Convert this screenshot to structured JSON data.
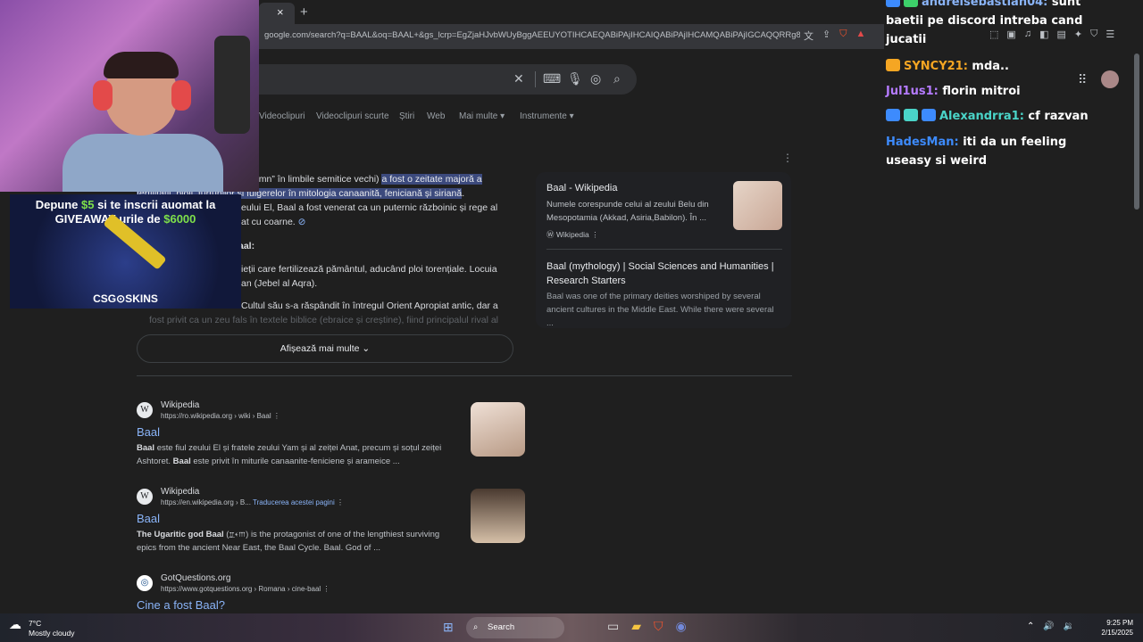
{
  "browser": {
    "tab_close": "×",
    "tab_new": "+",
    "url": "google.com/search?q=BAAL&oq=BAAL+&gs_lcrp=EgZjaHJvbWUyBggAEEUYOTIHCAEQABiPAjIHCAIQABiPAjIHCAMQABiPAjIGCAQQRRg8MgYI8...",
    "addr_icons": [
      "translate-icon",
      "share-icon",
      "brave-icon",
      "warning-icon"
    ]
  },
  "search": {
    "clear": "✕",
    "keyboard": "⌨",
    "mic": "🎤",
    "lens": "◎",
    "search": "⌕"
  },
  "filters": [
    "Videoclipuri",
    "Videoclipuri scurte",
    "Știri",
    "Web",
    "Mai multe ▾",
    "Instrumente ▾"
  ],
  "snippet": {
    "l1a": "au „domn” în limbile semitice vechi) ",
    "l1b": "a fost o zeitate majoră a",
    "l2": "fertilității, ploii, furtunilor și fulgerelor în mitologia canaanită, feniciană și siriană",
    "l2end": ".",
    "l3": "eului El, Baal a fost venerat ca un puternic războinic și rege al",
    "l4": "at cu coarne.",
    "l5": "aal:",
    "l6": "ieții care fertilizează pământul, aducând ploi torențiale. Locuia",
    "l7": "an (Jebel al Aqra).",
    "l8": "Cultul său s-a răspândit în întregul Orient Apropiat antic, dar a",
    "l9": "fost privit ca un zeu fals în textele biblice (ebraice și creștine), fiind principalul rival al",
    "show_more": "Afișează mai multe ⌄"
  },
  "side_cards": [
    {
      "title": "Baal - Wikipedia",
      "desc": "Numele corespunde celui al zeului Belu din Mesopotamia (Akkad, Asiria,Babilon). În ...",
      "source": "Wikipedia"
    },
    {
      "title": "Baal (mythology) | Social Sciences and Humanities | Research Starters",
      "desc": "Baal was one of the primary deities worshiped by several ancient cultures in the Middle East. While there were several ..."
    }
  ],
  "results": [
    {
      "fav": "W",
      "site": "Wikipedia",
      "url": "https://ro.wikipedia.org › wiki › Baal",
      "title": "Baal",
      "desc_b1": "Baal",
      "desc_t1": " este fiul zeului El și fratele zeului Yam și al zeiței Anat, precum și soțul zeiței Ashtoret. ",
      "desc_b2": "Baal",
      "desc_t2": " este privit în miturile canaanite-feniciene și arameice ..."
    },
    {
      "fav": "W",
      "site": "Wikipedia",
      "url": "https://en.wikipedia.org › B...",
      "translate": "Traducerea acestei pagini",
      "title": "Baal",
      "desc_b1": "The Ugaritic god Baal",
      "desc_t1": " (𐎁𐎓𐎍) is the protagonist of one of the lengthiest surviving epics from the ancient Near East, the Baal Cycle. Baal. God of ..."
    },
    {
      "fav": "◎",
      "site": "GotQuestions.org",
      "url": "https://www.gotquestions.org › Romana › cine-baal",
      "title": "Cine a fost Baal?"
    }
  ],
  "promo": {
    "line1_a": "Depune ",
    "line1_b": "$5",
    "line1_c": " si te inscrii auomat la",
    "line2_a": "GIVEAWAY-urile de ",
    "line2_b": "$6000",
    "logo": "CSG⊙SKINS"
  },
  "chat": [
    {
      "user": "andreisebastian04:",
      "color": "#8ab4f8",
      "text": " sunt baetii pe discord intreba cand jucatii"
    },
    {
      "user": "SYNCY21:",
      "color": "#f5a623",
      "text": " mda.."
    },
    {
      "user": "Jul1us1:",
      "color": "#b57bff",
      "text": " florin mitroi"
    },
    {
      "user": "Alexandrra1:",
      "color": "#4ad4c8",
      "text": " cf razvan"
    },
    {
      "user": "HadesMan:",
      "color": "#3d8bfd",
      "text": " iti da un feeling useasy si weird"
    }
  ],
  "taskbar": {
    "temp": "7°C",
    "cond": "Mostly cloudy",
    "search": "Search",
    "time": "9:25 PM",
    "date": "2/15/2025"
  },
  "colors": {
    "link": "#8ab4f8",
    "highlight": "#3c4a7d",
    "giveaway_green": "#7ee04a"
  }
}
